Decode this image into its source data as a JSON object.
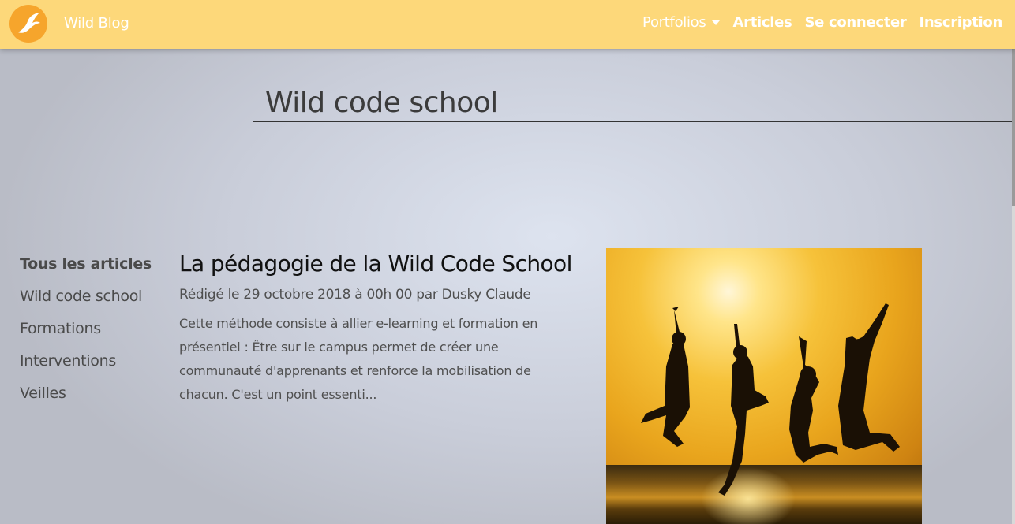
{
  "navbar": {
    "brand": "Wild Blog",
    "links": [
      {
        "label": "Portfolios"
      },
      {
        "label": "Articles"
      },
      {
        "label": "Se connecter"
      },
      {
        "label": "Inscription"
      }
    ]
  },
  "page": {
    "title": "Wild code school"
  },
  "sidebar": {
    "items": [
      {
        "label": "Tous les articles",
        "active": true
      },
      {
        "label": "Wild code school"
      },
      {
        "label": "Formations"
      },
      {
        "label": "Interventions"
      },
      {
        "label": "Veilles"
      }
    ]
  },
  "article": {
    "title": "La pédagogie de la Wild Code School",
    "meta": "Rédigé le 29 octobre 2018 à 00h 00 par Dusky Claude",
    "excerpt": "Cette méthode consiste à allier e-learning et formation en présentiel : Être sur le campus permet de créer une communauté d'apprenants et renforce la mobilisation de chacun. C'est un point essenti...",
    "image_icon": "jumping-people-sunset-photo"
  },
  "colors": {
    "navbar": "#fdd87a",
    "logo": "#f6a52c"
  }
}
